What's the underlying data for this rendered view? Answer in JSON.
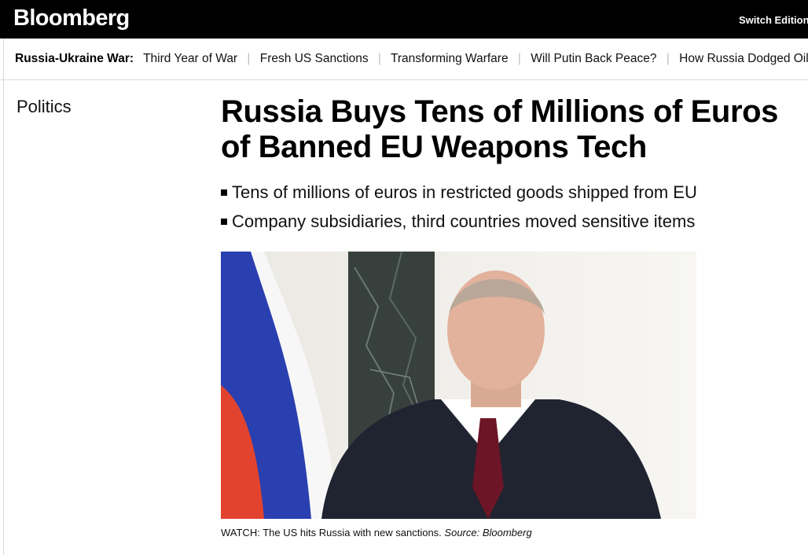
{
  "header": {
    "logo": "Bloomberg",
    "switch_edition": "Switch Edition"
  },
  "topics": {
    "label": "Russia-Ukraine War:",
    "items": [
      "Third Year of War",
      "Fresh US Sanctions",
      "Transforming Warfare",
      "Will Putin Back Peace?",
      "How Russia Dodged Oil"
    ]
  },
  "article": {
    "section": "Politics",
    "headline": "Russia Buys Tens of Millions of Euros of Banned EU Weapons Tech",
    "bullets": [
      "Tens of millions of euros in restricted goods shipped from EU",
      "Company subsidiaries, third countries moved sensitive items"
    ],
    "media": {
      "caption_text": "WATCH: The US hits Russia with new sanctions.",
      "caption_source": "Source: Bloomberg"
    }
  },
  "colors": {
    "header_bg": "#000000",
    "page_bg": "#ffffff",
    "flag_white": "#f7f7f7",
    "flag_blue": "#2a3fb0",
    "flag_red": "#e2432f"
  },
  "icons": [
    "square-bullet-icon"
  ]
}
